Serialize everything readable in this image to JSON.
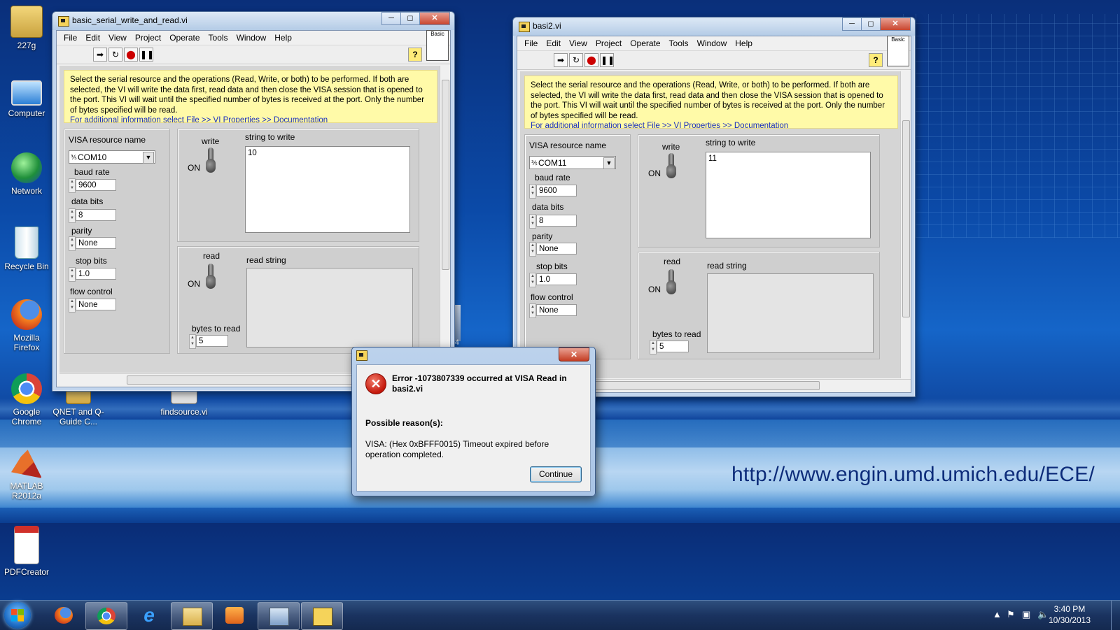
{
  "desktop": {
    "url_text": "http://www.engin.umd.umich.edu/ECE/",
    "icons": [
      {
        "label": "227g",
        "icon": "folder-user-icon"
      },
      {
        "label": "Computer",
        "icon": "computer-icon"
      },
      {
        "label": "Network",
        "icon": "network-icon"
      },
      {
        "label": "Recycle Bin",
        "icon": "recycle-bin-icon"
      },
      {
        "label": "Mozilla Firefox",
        "icon": "firefox-icon"
      },
      {
        "label": "Google Chrome",
        "icon": "chrome-icon"
      },
      {
        "label": "QNET and Q-Guide C...",
        "icon": "folder-icon"
      },
      {
        "label": "findsource.vi",
        "icon": "labview-vi-icon"
      },
      {
        "label": "MATLAB R2012a",
        "icon": "matlab-icon"
      },
      {
        "label": "PDFCreator",
        "icon": "pdf-icon"
      }
    ]
  },
  "menus": [
    "File",
    "Edit",
    "View",
    "Project",
    "Operate",
    "Tools",
    "Window",
    "Help"
  ],
  "palette_label": "Basic",
  "doc_text": "Select the serial resource and the operations (Read, Write, or both) to be performed.  If both are selected, the VI will write the data first, read data and then close the VISA session that is opened to the port.  This VI will wait until the specified number of bytes is received at the port. Only the number of bytes specified will be read.",
  "doc_link": "For additional information select File >> VI Properties >> Documentation",
  "labels": {
    "visa_resource": "VISA resource name",
    "baud_rate": "baud rate",
    "data_bits": "data bits",
    "parity": "parity",
    "stop_bits": "stop bits",
    "flow_control": "flow control",
    "write": "write",
    "read": "read",
    "on": "ON",
    "string_to_write": "string to write",
    "read_string": "read string",
    "bytes_to_read": "bytes to read"
  },
  "window1": {
    "title": "basic_serial_write_and_read.vi",
    "visa_resource": "COM10",
    "baud_rate": "9600",
    "data_bits": "8",
    "parity": "None",
    "stop_bits": "1.0",
    "flow_control": "None",
    "string_to_write": "10",
    "read_string": "",
    "bytes_to_read": "5"
  },
  "window2": {
    "title": "basi2.vi",
    "visa_resource": "COM11",
    "baud_rate": "9600",
    "data_bits": "8",
    "parity": "None",
    "stop_bits": "1.0",
    "flow_control": "None",
    "string_to_write": "11",
    "read_string": "",
    "bytes_to_read": "5"
  },
  "dialog": {
    "error_title": "Error -1073807339 occurred at VISA Read in basi2.vi",
    "reasons_heading": "Possible reason(s):",
    "reason_text": "VISA:  (Hex 0xBFFF0015) Timeout expired before operation completed.",
    "continue_label": "Continue"
  },
  "desktop_fragment": "-64",
  "taskbar": {
    "time": "3:40 PM",
    "date": "10/30/2013",
    "apps": [
      "firefox-icon",
      "chrome-icon",
      "internet-explorer-icon",
      "explorer-folder-icon",
      "media-player-icon",
      "network-tool-icon",
      "labview-icon"
    ]
  },
  "colors": {
    "doc_bg": "#fffaa8",
    "link": "#1a2fbf",
    "error_red": "#c4170b",
    "desktop_blue": "#0b4aa8"
  }
}
